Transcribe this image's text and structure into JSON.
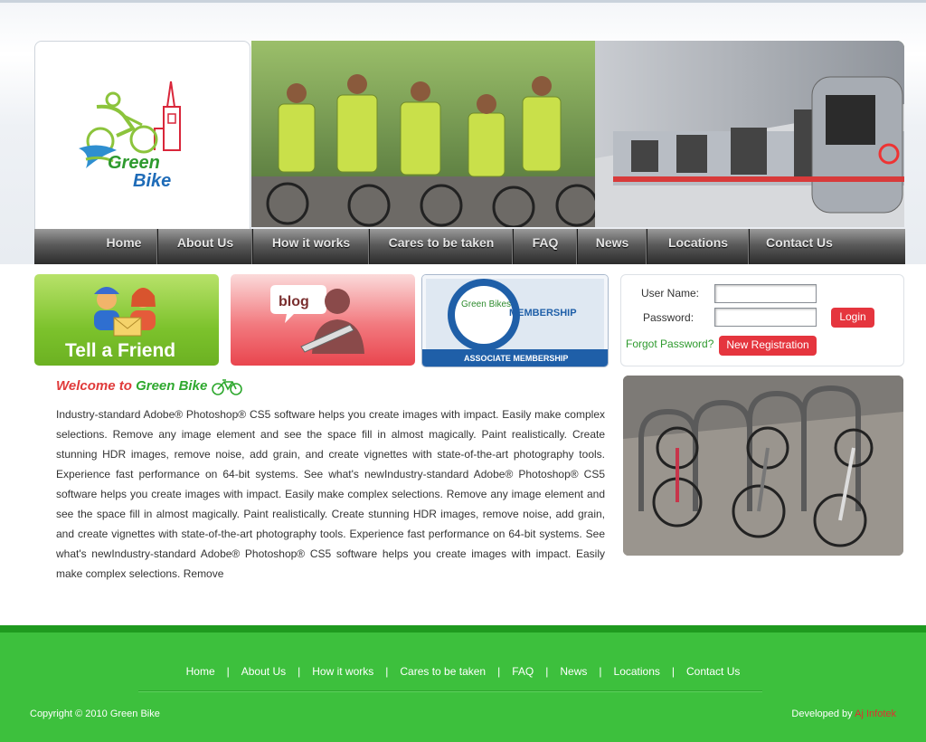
{
  "nav": {
    "items": [
      {
        "label": "Home"
      },
      {
        "label": "About Us"
      },
      {
        "label": "How it works"
      },
      {
        "label": "Cares to be taken"
      },
      {
        "label": "FAQ"
      },
      {
        "label": "News"
      },
      {
        "label": "Locations"
      },
      {
        "label": "Contact Us"
      }
    ]
  },
  "logo": {
    "line1": "Green",
    "line2": "Bike"
  },
  "promos": {
    "tell_friend": "Tell a Friend",
    "blog": "blog",
    "membership": {
      "brand": "Green Bikes",
      "title": "MEMBERSHIP",
      "sub": "ASSOCIATE MEMBERSHIP"
    }
  },
  "login": {
    "username_label": "User Name:",
    "password_label": "Password:",
    "username_value": "",
    "password_value": "",
    "login_button": "Login",
    "forgot": "Forgot Password?",
    "register": "New Registration"
  },
  "welcome": {
    "prefix": "Welcome to",
    "brand": "Green Bike"
  },
  "body_text": "Industry-standard Adobe® Photoshop® CS5 software helps you create images with impact. Easily make complex selections. Remove any image element and see the space fill in almost magically. Paint realistically. Create stunning HDR images, remove noise, add grain, and create vignettes with state-of-the-art photography tools. Experience fast performance on 64-bit systems. See what's newIndustry-standard Adobe® Photoshop® CS5 software helps you create images with impact. Easily make complex selections. Remove any image element and see the space fill in almost magically. Paint realistically. Create stunning HDR images, remove noise, add grain, and create vignettes with state-of-the-art photography tools. Experience fast performance on 64-bit systems. See what's newIndustry-standard Adobe® Photoshop® CS5 software helps you create images with impact. Easily make complex selections. Remove",
  "footer": {
    "links": [
      "Home",
      "About Us",
      "How it works",
      "Cares to be taken",
      "FAQ",
      "News",
      "Locations",
      "Contact Us"
    ],
    "separator": "|",
    "copyright": "Copyright © 2010 Green Bike",
    "developed_prefix": "Developed by",
    "developer": "Aj Infotek"
  },
  "colors": {
    "brand_green": "#3dc03d",
    "accent_red": "#e5353e",
    "link_green": "#2e9a2e"
  }
}
